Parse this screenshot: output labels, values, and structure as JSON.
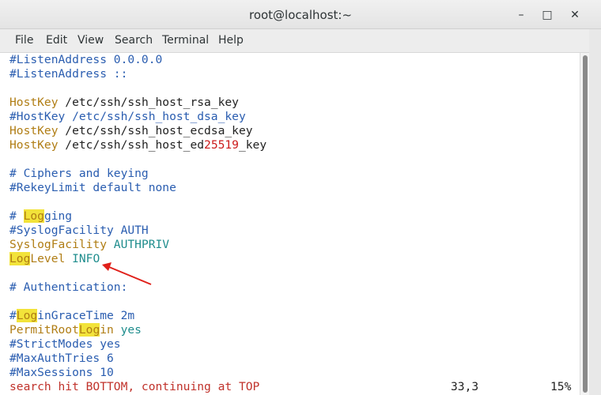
{
  "window": {
    "title": "root@localhost:~"
  },
  "controls": {
    "minimize": "–",
    "maximize": "□",
    "close": "✕"
  },
  "menu": [
    "File",
    "Edit",
    "View",
    "Search",
    "Terminal",
    "Help"
  ],
  "lines": {
    "l1": "#ListenAddress 0.0.0.0",
    "l2": "#ListenAddress ::",
    "l4a": "HostKey",
    "l4b": " /etc/ssh/ssh_host_rsa_key",
    "l5": "#HostKey /etc/ssh/ssh_host_dsa_key",
    "l6a": "HostKey",
    "l6b": " /etc/ssh/ssh_host_ecdsa_key",
    "l7a": "HostKey",
    "l7b": " /etc/ssh/ssh_host_ed",
    "l7c": "25519",
    "l7d": "_key",
    "l9": "# Ciphers and keying",
    "l10": "#RekeyLimit default none",
    "l12a": "# ",
    "l12b": "Log",
    "l12c": "ging",
    "l13": "#SyslogFacility AUTH",
    "l14a": "SyslogFacility",
    "l14b": " AUTHPRIV",
    "l15a": "Log",
    "l15b": "Level",
    "l15c": " INFO",
    "l17": "# Authentication:",
    "l19a": "#",
    "l19b": "Log",
    "l19c": "inGraceTime 2m",
    "l20a": "PermitRoot",
    "l20b": "Log",
    "l20c": "in",
    "l20d": " yes",
    "l21": "#StrictModes yes",
    "l22": "#MaxAuthTries 6",
    "l23": "#MaxSessions 10"
  },
  "status": {
    "message": "search hit BOTTOM, continuing at TOP",
    "position": "33,3",
    "percent": "15%"
  },
  "colors": {
    "comment": "#2a5db0",
    "keyword": "#b07d14",
    "value": "#1f8d8d",
    "number": "#cc1a1a",
    "search_highlight": "#f2e33a",
    "annotation_arrow": "#e0201a"
  }
}
